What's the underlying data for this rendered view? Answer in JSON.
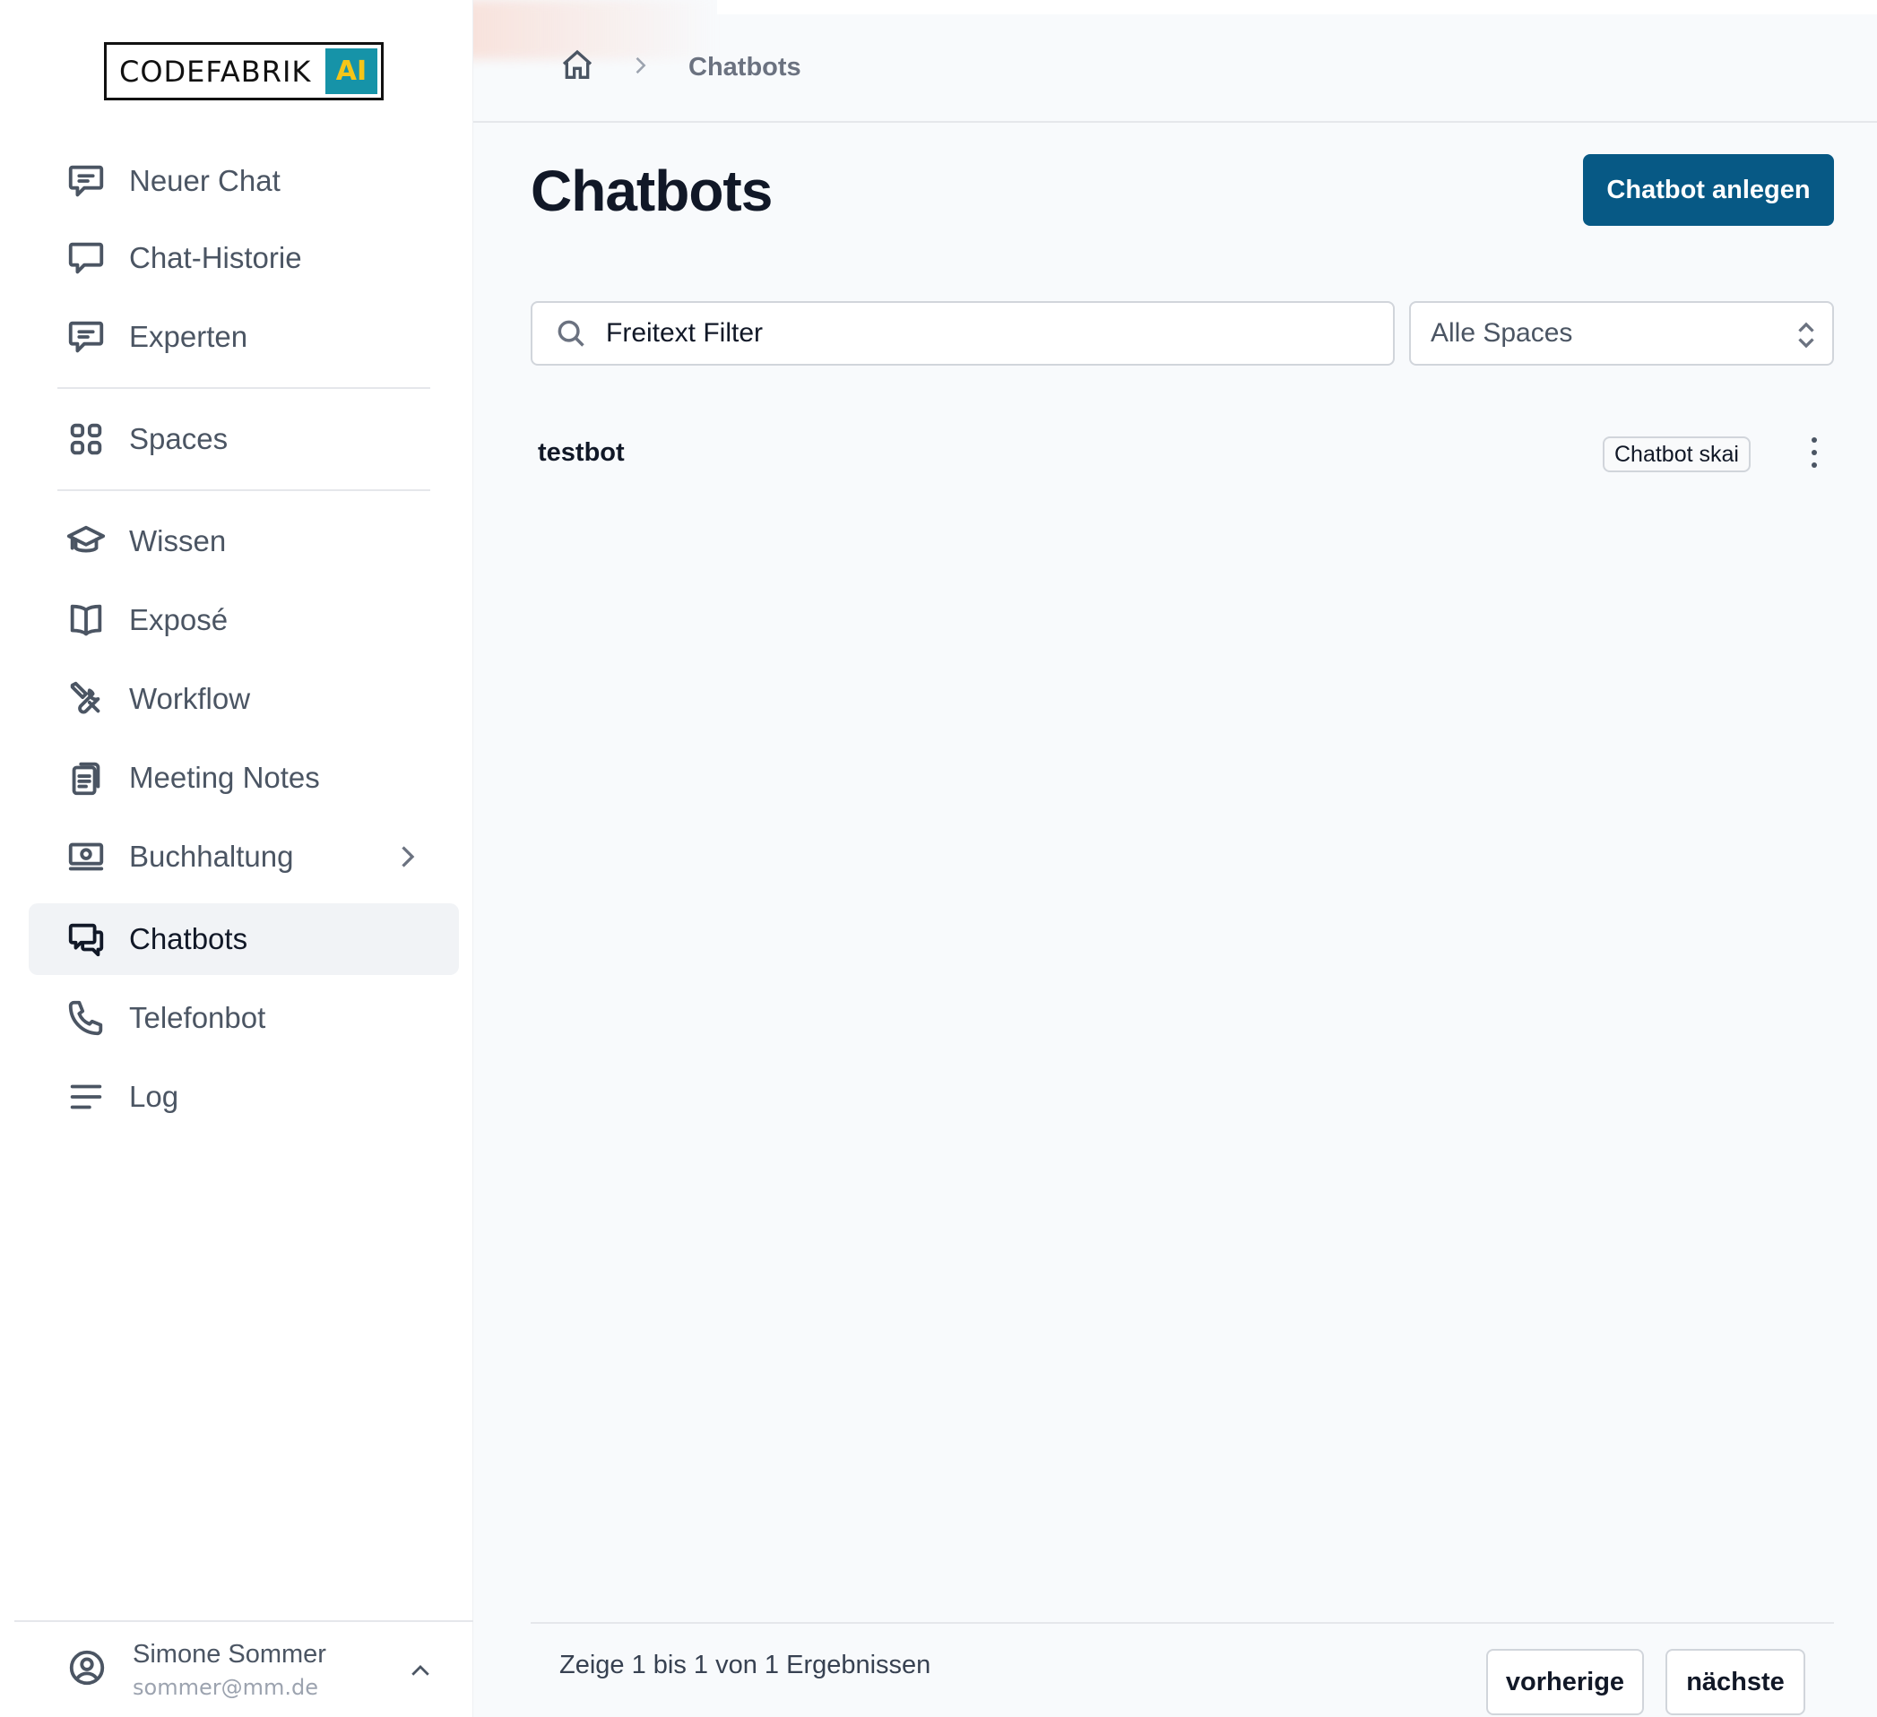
{
  "logo": {
    "text": "CODEFABRIK",
    "badge": "AI"
  },
  "breadcrumb": {
    "current": "Chatbots"
  },
  "sidebar": {
    "items": [
      {
        "label": "Neuer Chat",
        "icon": "chat-lines-icon"
      },
      {
        "label": "Chat-Historie",
        "icon": "chat-bubble-icon"
      },
      {
        "label": "Experten",
        "icon": "chat-lines-icon"
      },
      {
        "label": "Spaces",
        "icon": "grid-icon"
      },
      {
        "label": "Wissen",
        "icon": "graduation-cap-icon"
      },
      {
        "label": "Exposé",
        "icon": "book-icon"
      },
      {
        "label": "Workflow",
        "icon": "wrench-screwdriver-icon"
      },
      {
        "label": "Meeting Notes",
        "icon": "clipboard-icon"
      },
      {
        "label": "Buchhaltung",
        "icon": "banknotes-icon"
      },
      {
        "label": "Chatbots",
        "icon": "chat-bubbles-icon"
      },
      {
        "label": "Telefonbot",
        "icon": "phone-icon"
      },
      {
        "label": "Log",
        "icon": "bars-icon"
      }
    ],
    "active": "Chatbots"
  },
  "user": {
    "name": "Simone Sommer",
    "email": "sommer@mm.de"
  },
  "page": {
    "title": "Chatbots",
    "create_button": "Chatbot anlegen",
    "search_placeholder": "Freitext Filter",
    "space_filter": "Alle Spaces"
  },
  "chatbots": [
    {
      "name": "testbot",
      "badge": "Chatbot skai"
    }
  ],
  "pagination": {
    "summary": "Zeige 1 bis 1 von 1 Ergebnissen",
    "prev": "vorherige",
    "next": "nächste"
  },
  "colors": {
    "primary": "#075985",
    "logo_ai_bg": "#1693a8",
    "logo_ai_text": "#f5c518"
  }
}
